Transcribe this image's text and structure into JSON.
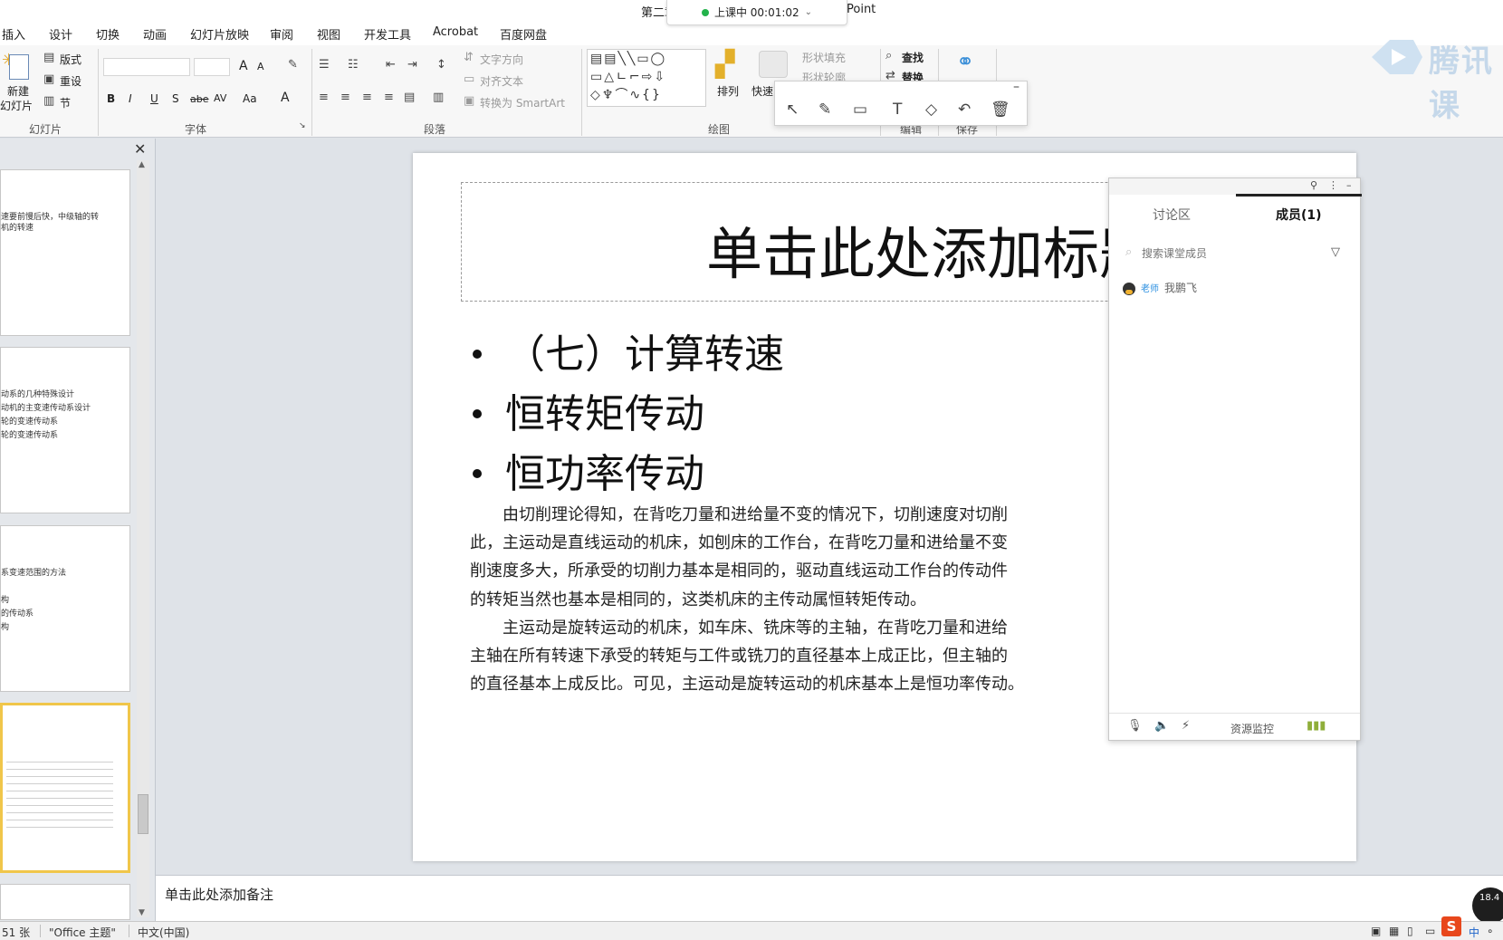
{
  "window": {
    "title_left": "第二章",
    "title_right": "Point"
  },
  "class_timer": {
    "label": "上课中 00:01:02"
  },
  "menu_tabs": [
    "插入",
    "设计",
    "切换",
    "动画",
    "幻灯片放映",
    "审阅",
    "视图",
    "开发工具",
    "Acrobat",
    "百度网盘"
  ],
  "ribbon": {
    "slides": {
      "new_slide_line1": "新建",
      "new_slide_line2": "幻灯片",
      "layout": "版式",
      "reset": "重设",
      "section": "节",
      "group_label": "幻灯片"
    },
    "font": {
      "group_label": "字体",
      "bold": "B",
      "italic": "I",
      "underline": "U",
      "strike": "S",
      "abc": "abe",
      "spacing": "AV",
      "case": "Aa",
      "color": "A",
      "grow": "A",
      "shrink": "A"
    },
    "paragraph": {
      "text_direction": "文字方向",
      "align_text": "对齐文本",
      "smartart": "转换为 SmartArt",
      "group_label": "段落"
    },
    "drawing": {
      "arrange": "排列",
      "quick_styles": "快速",
      "shape_fill": "形状填充",
      "shape_outline": "形状轮廓",
      "group_label": "绘图"
    },
    "editing": {
      "find": "查找",
      "replace": "替换",
      "group_label": "编辑"
    },
    "save": {
      "group_label": "保存"
    }
  },
  "brand": {
    "text": "腾讯课"
  },
  "annotation_tools": [
    "select-arrow",
    "pen",
    "rectangle",
    "text",
    "eraser",
    "undo",
    "delete"
  ],
  "thumbnails": [
    {
      "lines": [
        "速要前慢后快，中级轴的转",
        "机的转速"
      ]
    },
    {
      "lines": [
        "动系的几种特殊设计",
        "动机的主变速传动系设计",
        "轮的变速传动系",
        "轮的变速传动系"
      ]
    },
    {
      "lines": [
        "系变速范围的方法",
        "",
        "",
        "构",
        "的传动系",
        "构"
      ]
    },
    {
      "lines": [
        "",
        "",
        "",
        "",
        ""
      ]
    }
  ],
  "slide": {
    "title": "单击此处添加标题",
    "bullets": [
      "（七）计算转速",
      "恒转矩传动",
      "恒功率传动"
    ],
    "body": [
      "　　由切削理论得知，在背吃刀量和进给量不变的情况下，切削速度对切削",
      "此，主运动是直线运动的机床，如刨床的工作台，在背吃刀量和进给量不变",
      "削速度多大，所承受的切削力基本是相同的，驱动直线运动工作台的传动件",
      "的转矩当然也基本是相同的，这类机床的主传动属恒转矩传动。",
      "　　主运动是旋转运动的机床，如车床、铣床等的主轴，在背吃刀量和进给",
      "主轴在所有转速下承受的转矩与工件或铣刀的直径基本上成正比，但主轴的",
      "的直径基本上成反比。可见，主运动是旋转运动的机床基本上是恒功率传动。"
    ]
  },
  "class_panel": {
    "tabs": [
      "讨论区",
      "成员(1)"
    ],
    "active_tab": "成员(1)",
    "search_placeholder": "搜索课堂成员",
    "members": [
      {
        "role": "老师",
        "name": "我鹏飞"
      }
    ],
    "bottom_label": "资源监控"
  },
  "notes": {
    "placeholder": "单击此处添加备注"
  },
  "status": {
    "slide_count": "51 张",
    "theme": "\"Office 主题\"",
    "language": "中文(中国)"
  },
  "net": {
    "speed": "18.4"
  },
  "colors": {
    "accent_selected_thumb": "#f0c64a",
    "timer_dot": "#23b24b",
    "role_blue": "#2b8fe0"
  }
}
